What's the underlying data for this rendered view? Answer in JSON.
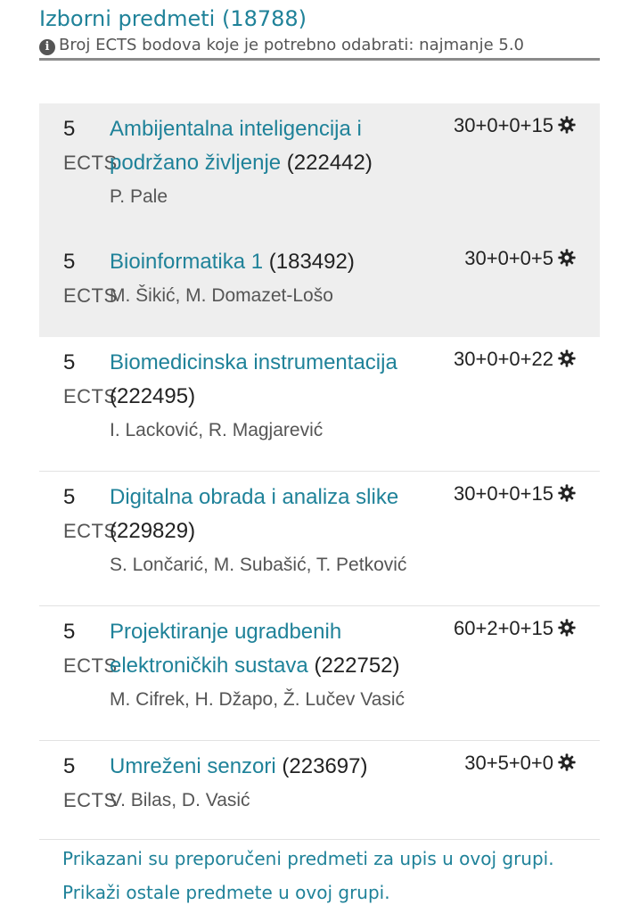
{
  "header": {
    "title": "Izborni predmeti (18788)",
    "info_text": "Broj ECTS bodova koje je potrebno odabrati: najmanje 5.0"
  },
  "courses": [
    {
      "ects": "5",
      "ects_unit": "ECTS",
      "name": "Ambijentalna inteligencija i podržano življenje",
      "code": "(222442)",
      "lecturers": "P. Pale",
      "hours": "30+0+0+15",
      "shaded": true
    },
    {
      "ects": "5",
      "ects_unit": "ECTS",
      "name": "Bioinformatika 1",
      "code": "(183492)",
      "lecturers": "M. Šikić, M. Domazet-Lošo",
      "hours": "30+0+0+5",
      "shaded": true
    },
    {
      "ects": "5",
      "ects_unit": "ECTS",
      "name": "Biomedicinska instrumentacija",
      "code": "(222495)",
      "lecturers": "I. Lacković, R. Magjarević",
      "hours": "30+0+0+22",
      "shaded": false
    },
    {
      "ects": "5",
      "ects_unit": "ECTS",
      "name": "Digitalna obrada i analiza slike",
      "code": "(229829)",
      "lecturers": "S. Lončarić, M. Subašić, T. Petković",
      "hours": "30+0+0+15",
      "shaded": false
    },
    {
      "ects": "5",
      "ects_unit": "ECTS",
      "name": "Projektiranje ugradbenih elektroničkih sustava",
      "code": "(222752)",
      "lecturers": "M. Cifrek, H. Džapo, Ž. Lučev Vasić",
      "hours": "60+2+0+15",
      "shaded": false
    },
    {
      "ects": "5",
      "ects_unit": "ECTS",
      "name": "Umreženi senzori",
      "code": "(223697)",
      "lecturers": "V. Bilas, D. Vasić",
      "hours": "30+5+0+0",
      "shaded": false
    }
  ],
  "footer": {
    "text": "Prikazani su preporučeni predmeti za upis u ovoj grupi. Prikaži ostale predmete u ovoj grupi."
  },
  "icons": {
    "info": "info-circle-icon",
    "settings": "gear-icon"
  },
  "colors": {
    "accent": "#1f8299",
    "shaded_row": "#eeeeee"
  }
}
